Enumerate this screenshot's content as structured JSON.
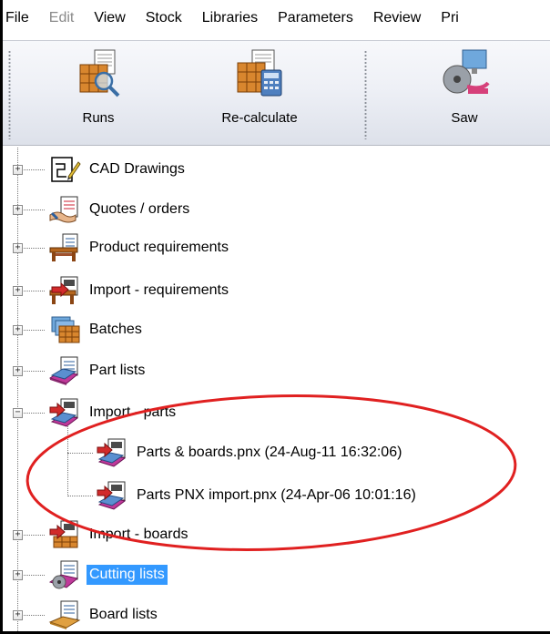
{
  "menubar": {
    "items": [
      {
        "label": "File",
        "disabled": false
      },
      {
        "label": "Edit",
        "disabled": true
      },
      {
        "label": "View",
        "disabled": false
      },
      {
        "label": "Stock",
        "disabled": false
      },
      {
        "label": "Libraries",
        "disabled": false
      },
      {
        "label": "Parameters",
        "disabled": false
      },
      {
        "label": "Review",
        "disabled": false
      },
      {
        "label": "Pri",
        "disabled": false
      }
    ]
  },
  "toolbar": {
    "runs_label": "Runs",
    "recalculate_label": "Re-calculate",
    "saw_label": "Saw"
  },
  "tree": {
    "items": [
      {
        "label": "CAD Drawings",
        "icon": "cad-drawing-icon",
        "expanded": false
      },
      {
        "label": "Quotes / orders",
        "icon": "quotes-icon",
        "expanded": false
      },
      {
        "label": "Product requirements",
        "icon": "product-requirements-icon",
        "expanded": false
      },
      {
        "label": "Import - requirements",
        "icon": "import-requirements-icon",
        "expanded": false
      },
      {
        "label": "Batches",
        "icon": "batches-icon",
        "expanded": false
      },
      {
        "label": "Part lists",
        "icon": "part-lists-icon",
        "expanded": false
      },
      {
        "label": "Import - parts",
        "icon": "import-parts-icon",
        "expanded": true,
        "children": [
          {
            "label": "Parts & boards.pnx (24-Aug-11 16:32:06)",
            "icon": "pnx-file-icon"
          },
          {
            "label": "Parts PNX import.pnx (24-Apr-06 10:01:16)",
            "icon": "pnx-file-icon"
          }
        ]
      },
      {
        "label": "Import - boards",
        "icon": "import-boards-icon",
        "expanded": false
      },
      {
        "label": "Cutting lists",
        "icon": "cutting-lists-icon",
        "expanded": false,
        "selected": true
      },
      {
        "label": "Board lists",
        "icon": "board-lists-icon",
        "expanded": false
      }
    ],
    "expander_collapsed": "+",
    "expander_expanded": "−"
  },
  "colors": {
    "selection": "#3399ff",
    "annotation": "#e02020"
  }
}
